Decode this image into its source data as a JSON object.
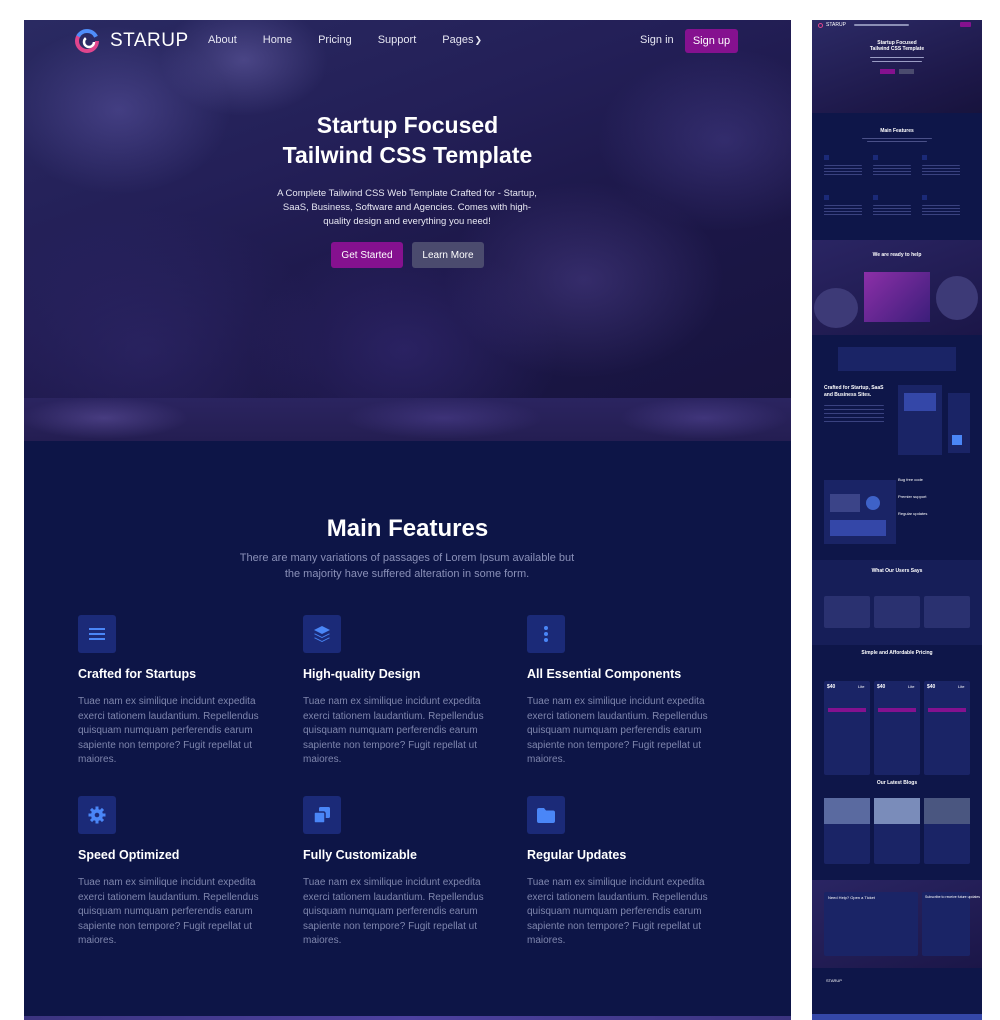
{
  "brand": {
    "name": "STARUP"
  },
  "nav": {
    "links": [
      "About",
      "Home",
      "Pricing",
      "Support",
      "Pages"
    ],
    "signin": "Sign in",
    "signup": "Sign up"
  },
  "hero": {
    "title_line1": "Startup Focused",
    "title_line2": "Tailwind CSS Template",
    "subtitle": "A Complete Tailwind CSS Web Template Crafted for - Startup, SaaS, Business, Software and Agencies. Comes with high-quality design and everything you need!",
    "primary_button": "Get Started",
    "secondary_button": "Learn More"
  },
  "features": {
    "title": "Main Features",
    "subtitle": "There are many variations of passages of Lorem Ipsum available but the majority have suffered alteration in some form.",
    "items": [
      {
        "icon": "menu-icon",
        "title": "Crafted for Startups",
        "text": "Tuae nam ex similique incidunt expedita exerci tationem laudantium. Repellendus quisquam numquam perferendis earum sapiente non tempore? Fugit repellat ut maiores."
      },
      {
        "icon": "layers-icon",
        "title": "High-quality Design",
        "text": "Tuae nam ex similique incidunt expedita exerci tationem laudantium. Repellendus quisquam numquam perferendis earum sapiente non tempore? Fugit repellat ut maiores."
      },
      {
        "icon": "dots-vertical-icon",
        "title": "All Essential Components",
        "text": "Tuae nam ex similique incidunt expedita exerci tationem laudantium. Repellendus quisquam numquam perferendis earum sapiente non tempore? Fugit repellat ut maiores."
      },
      {
        "icon": "gear-icon",
        "title": "Speed Optimized",
        "text": "Tuae nam ex similique incidunt expedita exerci tationem laudantium. Repellendus quisquam numquam perferendis earum sapiente non tempore? Fugit repellat ut maiores."
      },
      {
        "icon": "copy-icon",
        "title": "Fully Customizable",
        "text": "Tuae nam ex similique incidunt expedita exerci tationem laudantium. Repellendus quisquam numquam perferendis earum sapiente non tempore? Fugit repellat ut maiores."
      },
      {
        "icon": "folder-icon",
        "title": "Regular Updates",
        "text": "Tuae nam ex similique incidunt expedita exerci tationem laudantium. Repellendus quisquam numquam perferendis earum sapiente non tempore? Fugit repellat ut maiores."
      }
    ]
  },
  "thumbnail": {
    "hero_title_line1": "Startup Focused",
    "hero_title_line2": "Tailwind CSS Template",
    "features_title": "Main Features",
    "help_title": "We are ready to help",
    "crafted_title_line1": "Crafted for Startup, SaaS",
    "crafted_title_line2": "and Business Sites.",
    "bug_title": "Bug free code",
    "support_title": "Premier support",
    "updates_title": "Regular updates",
    "users_title": "What Our Users Says",
    "pricing_title": "Simple and Affordable Pricing",
    "price": "$40",
    "plans": [
      "Lite",
      "Lite",
      "Lite"
    ],
    "blogs_title": "Our Latest Blogs",
    "ticket_title": "Need Help? Open a Ticket",
    "subscribe_title": "Subscribe to receive future updates",
    "footer_brand": "STARUP"
  },
  "colors": {
    "accent": "#85118f",
    "background": "#0d1547",
    "icon_bg": "#1b2a78",
    "icon_fg": "#4a86f7"
  }
}
